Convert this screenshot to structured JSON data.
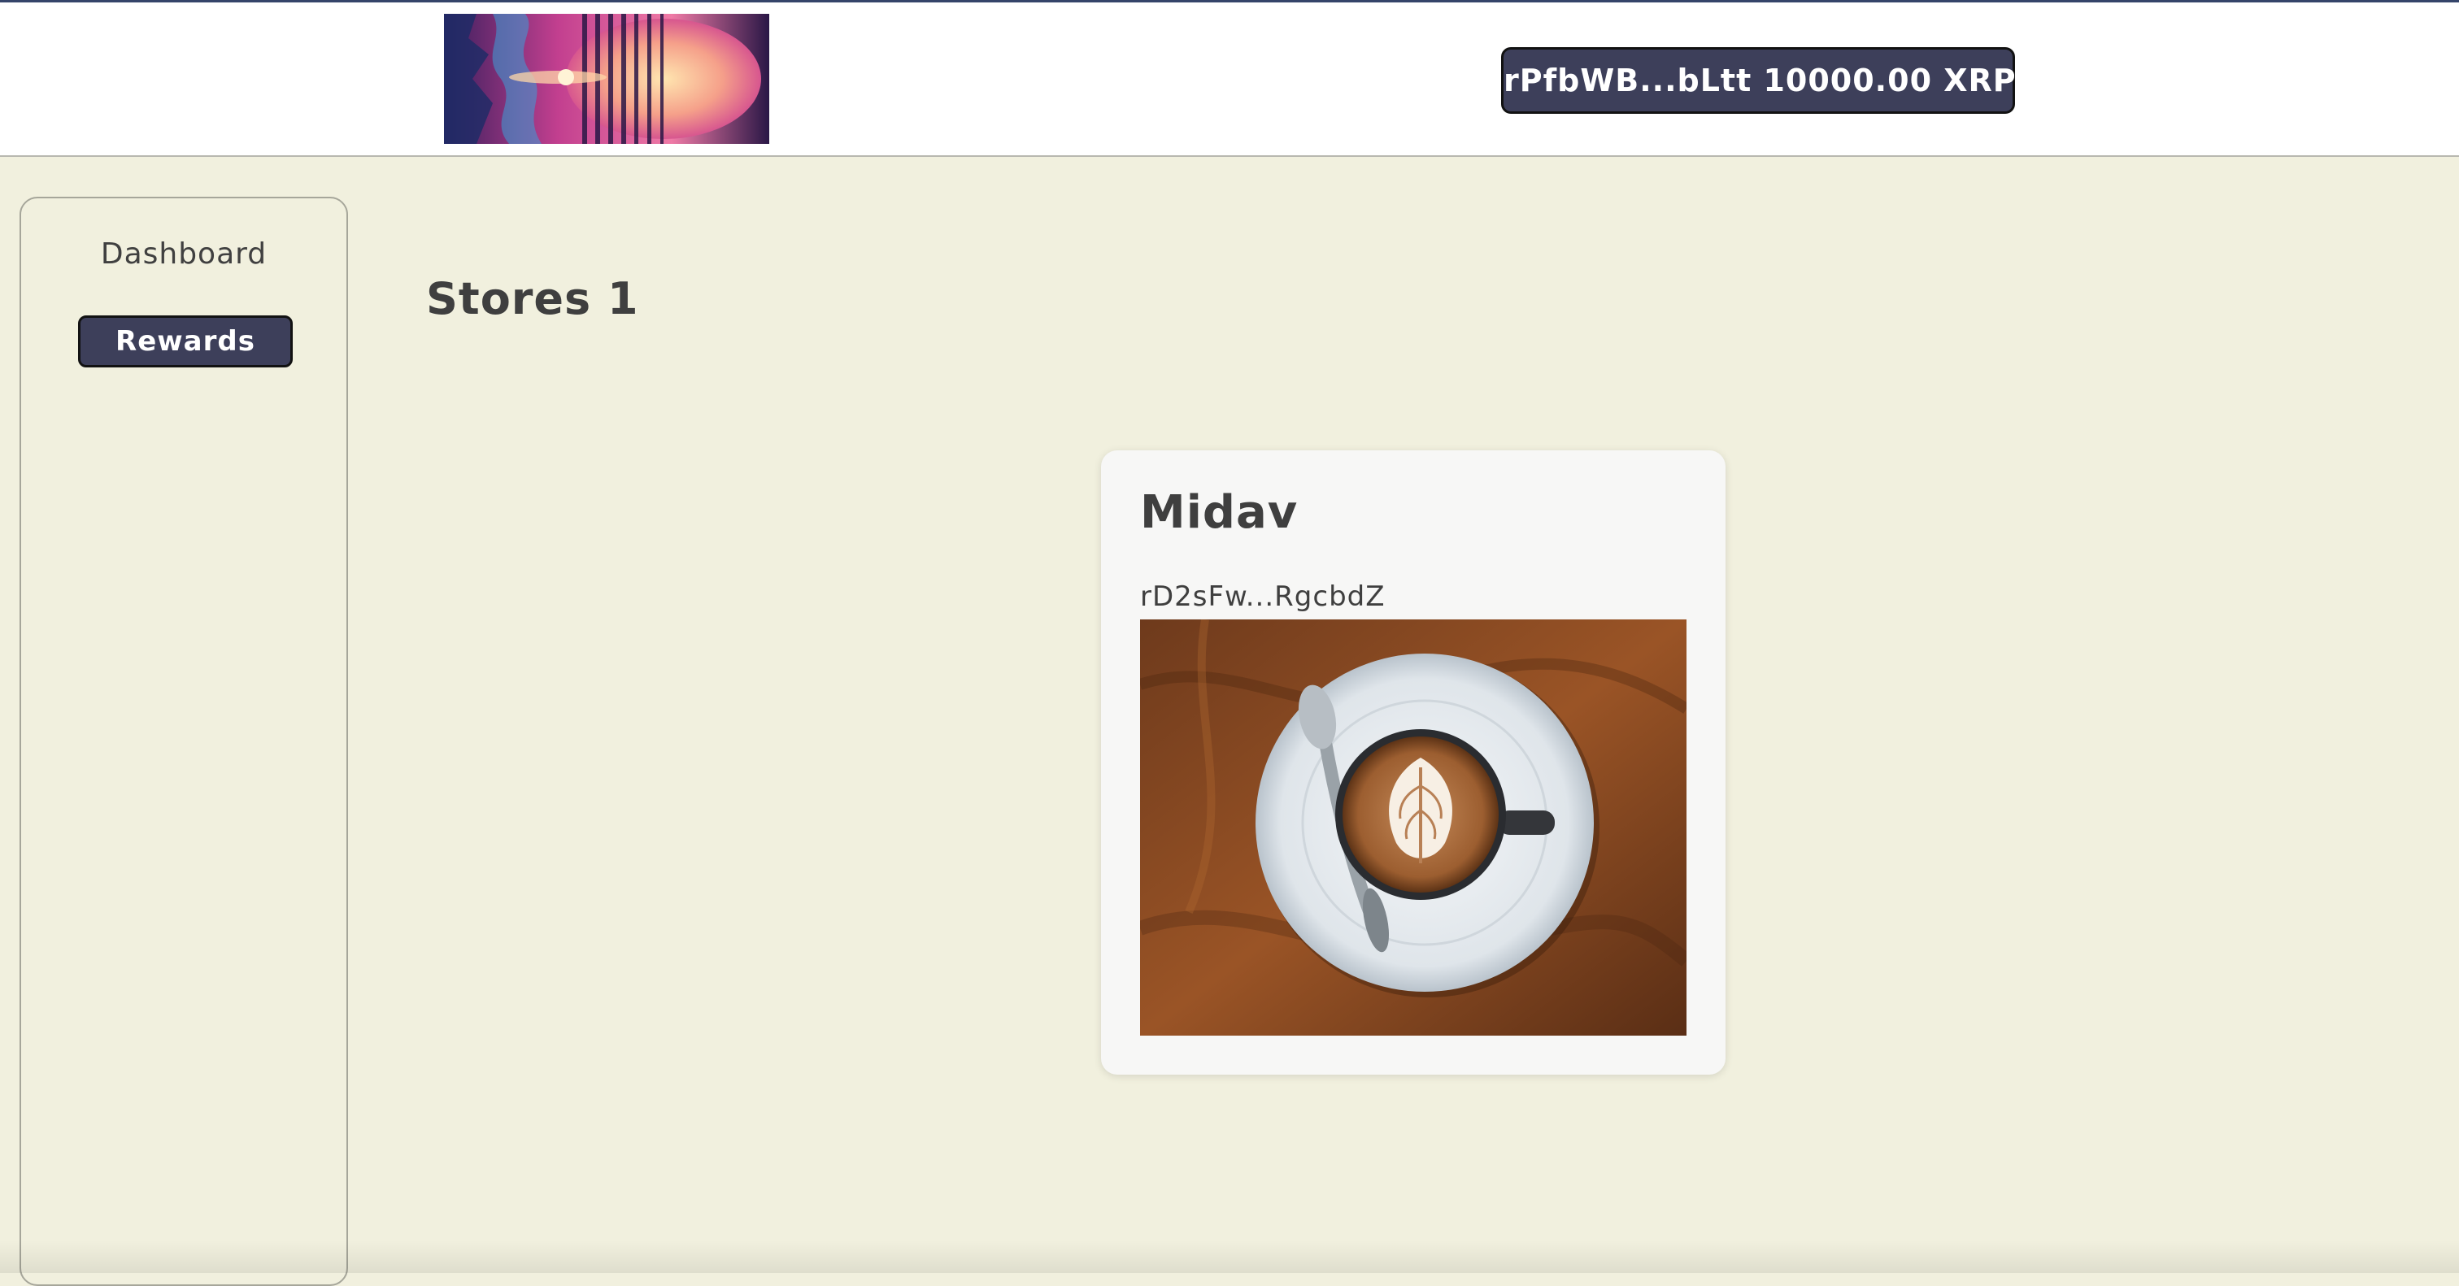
{
  "header": {
    "logo_icon": "synthwave-logo",
    "wallet": {
      "label": "rPfbWB...bLtt 10000.00 XRP"
    }
  },
  "sidebar": {
    "items": [
      {
        "label": "Dashboard",
        "active": false
      },
      {
        "label": "Rewards",
        "active": true
      }
    ]
  },
  "main": {
    "title": "Stores 1",
    "stores": [
      {
        "name": "Midav",
        "address": "rD2sFw...RgcbdZ",
        "image_icon": "latte-coffee-photo"
      }
    ]
  },
  "colors": {
    "background": "#f1f0de",
    "header_bg": "#ffffff",
    "button_bg": "#3d3f5a",
    "button_border": "#121212",
    "text": "#3f3f3f",
    "card_bg": "#f7f7f6"
  }
}
